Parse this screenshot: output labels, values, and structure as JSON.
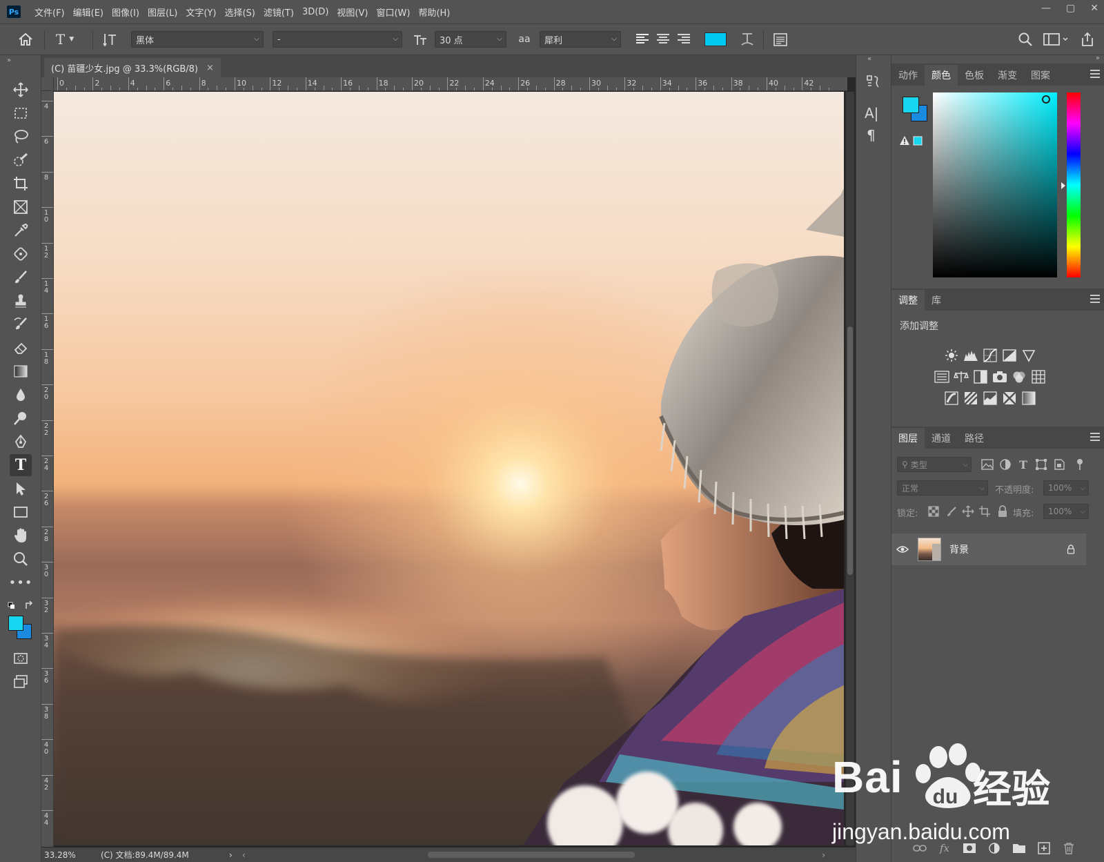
{
  "app": {
    "logo": "Ps"
  },
  "menu": [
    "文件(F)",
    "编辑(E)",
    "图像(I)",
    "图层(L)",
    "文字(Y)",
    "选择(S)",
    "滤镜(T)",
    "3D(D)",
    "视图(V)",
    "窗口(W)",
    "帮助(H)"
  ],
  "window_controls": {
    "minimize": "—",
    "maximize": "▢",
    "close": "✕"
  },
  "options": {
    "font_family": "黑体",
    "font_style": "-",
    "font_size": "30 点",
    "aa_label": "aa",
    "antialias": "犀利",
    "text_color": "#00c8f0"
  },
  "document": {
    "tab_title": "(C) 苗疆少女.jpg @ 33.3%(RGB/8)",
    "close": "×",
    "zoom": "33.28%",
    "doc_info": "(C) 文档:89.4M/89.4M",
    "status_arrow": "›"
  },
  "rulers": {
    "h": [
      "0",
      "2",
      "4",
      "6",
      "8",
      "10",
      "12",
      "14",
      "16",
      "18",
      "20",
      "22",
      "24",
      "26",
      "28",
      "30",
      "32",
      "34",
      "36",
      "38",
      "40",
      "42"
    ],
    "v": [
      "4",
      "6",
      "8",
      "10",
      "12",
      "14",
      "16",
      "18",
      "20",
      "22",
      "24",
      "26",
      "28",
      "30",
      "32",
      "34",
      "36",
      "38",
      "40",
      "42",
      "44"
    ]
  },
  "colors": {
    "foreground": "#18d6f0",
    "background": "#1a8be0"
  },
  "color_panel": {
    "tabs": [
      "动作",
      "颜色",
      "色板",
      "渐变",
      "图案"
    ],
    "active": "颜色"
  },
  "adjust_panel": {
    "tabs": [
      "调整",
      "库"
    ],
    "active": "调整",
    "title": "添加调整"
  },
  "layers_panel": {
    "tabs": [
      "图层",
      "通道",
      "路径"
    ],
    "active": "图层",
    "filter_placeholder": "类型",
    "blend_mode": "正常",
    "opacity_label": "不透明度:",
    "opacity": "100%",
    "lock_label": "锁定:",
    "fill_label": "填充:",
    "fill": "100%",
    "layers": [
      {
        "name": "背景",
        "locked": true,
        "visible": true
      }
    ]
  },
  "watermark": {
    "brand": "Bai",
    "brand2": "经验",
    "url": "jingyan.baidu.com"
  }
}
